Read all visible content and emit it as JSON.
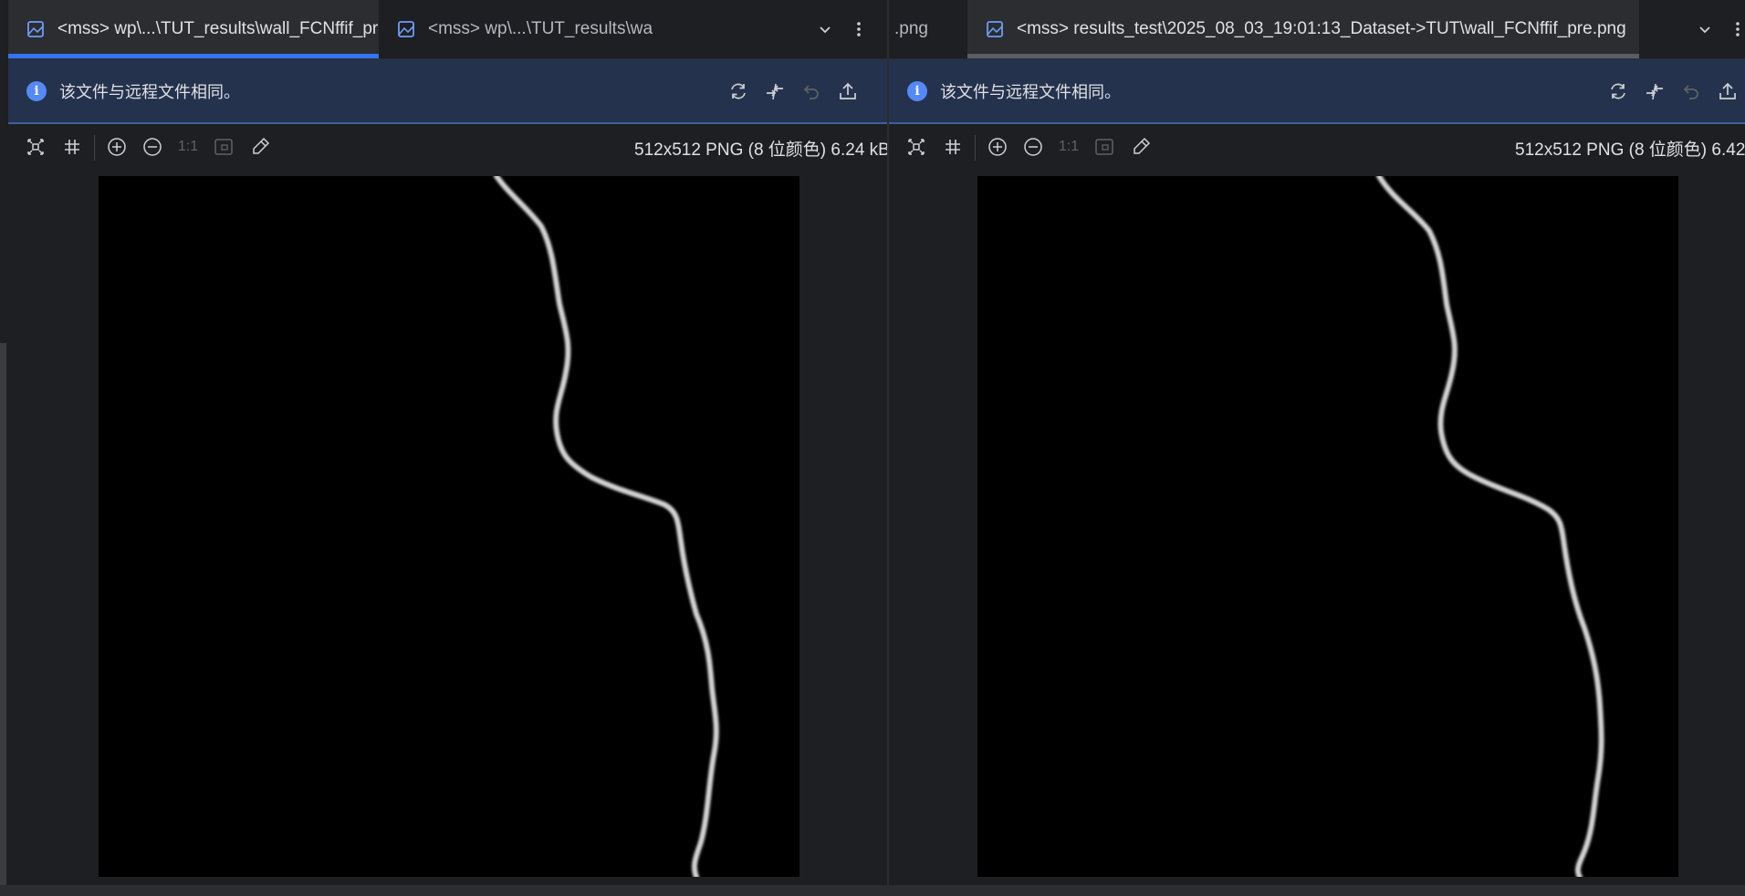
{
  "left": {
    "tabs": [
      {
        "label": "<mss> wp\\...\\TUT_results\\wall_FCNffif_pre.png",
        "active": true
      },
      {
        "label": "<mss> wp\\...\\TUT_results\\wall_EsCtO",
        "active": false
      }
    ],
    "banner": {
      "message": "该文件与远程文件相同。"
    },
    "toolbar": {
      "actual_size": "1:1"
    },
    "image_info": "512x512 PNG (8 位颜色) 6.24 kB"
  },
  "right": {
    "tabs": [
      {
        "label": ".png",
        "active": false
      },
      {
        "label": "<mss> results_test\\2025_08_03_19:01:13_Dataset->TUT\\wall_FCNffif_pre.png",
        "active": true
      }
    ],
    "banner": {
      "message": "该文件与远程文件相同。"
    },
    "toolbar": {
      "actual_size": "1:1"
    },
    "image_info": "512x512 PNG (8 位颜色) 6.42"
  },
  "icons": {
    "tab_file": "image-file-icon",
    "close": "close-icon",
    "dropdown": "chevron-down-icon",
    "more": "more-vertical-icon",
    "info": "info-icon",
    "refresh": "refresh-icon",
    "compare": "compare-icon",
    "revert": "revert-icon",
    "upload": "upload-icon",
    "fit": "fit-to-window-icon",
    "grid": "grid-icon",
    "zoom_in": "zoom-in-icon",
    "zoom_out": "zoom-out-icon",
    "fit_disabled": "fit-zoom-icon",
    "color_picker": "color-picker-icon"
  },
  "colors": {
    "accent": "#3574f0",
    "banner_bg": "#25324d",
    "editor_bg": "#1e1f22",
    "image_bg": "#000000",
    "crack": "#ffffff"
  }
}
